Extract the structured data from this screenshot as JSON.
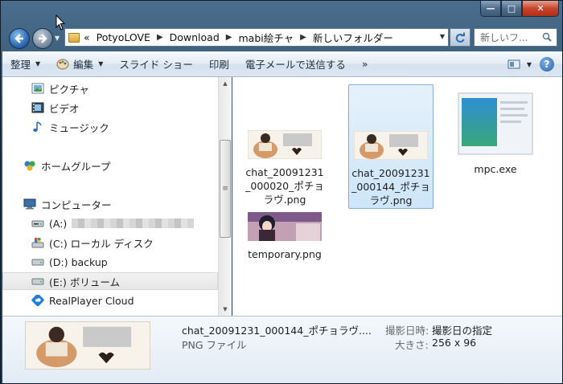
{
  "window": {
    "minimize": "—",
    "maximize": "□",
    "close": "✕"
  },
  "address": {
    "prefix": "«",
    "crumbs": [
      "PotyoLOVE",
      "Download",
      "mabi絵チャ",
      "新しいフォルダー"
    ]
  },
  "search": {
    "placeholder": "新しいフ..."
  },
  "commands": {
    "organize": "整理",
    "edit": "編集",
    "slideshow": "スライド ショー",
    "print": "印刷",
    "email": "電子メールで送信する",
    "more": "»"
  },
  "nav": {
    "pictures": "ピクチャ",
    "videos": "ビデオ",
    "music": "ミュージック",
    "homegroup": "ホームグループ",
    "computer": "コンピューター",
    "drive_a": "(A:)",
    "drive_c": "(C:) ローカル ディスク",
    "drive_d": "(D:) backup",
    "drive_e": "(E:) ボリューム",
    "realplayer": "RealPlayer Cloud"
  },
  "files": [
    {
      "name": "chat_20091231_000020_ポチョラヴ.png"
    },
    {
      "name": "chat_20091231_000144_ポチョラヴ.png"
    },
    {
      "name": "mpc.exe"
    },
    {
      "name": "temporary.png"
    }
  ],
  "details": {
    "name": "chat_20091231_000144_ポチョラヴ....",
    "type": "PNG ファイル",
    "date_label": "撮影日時:",
    "date_value": "撮影日の指定",
    "size_label": "大きさ:",
    "size_value": "256 x 96"
  }
}
